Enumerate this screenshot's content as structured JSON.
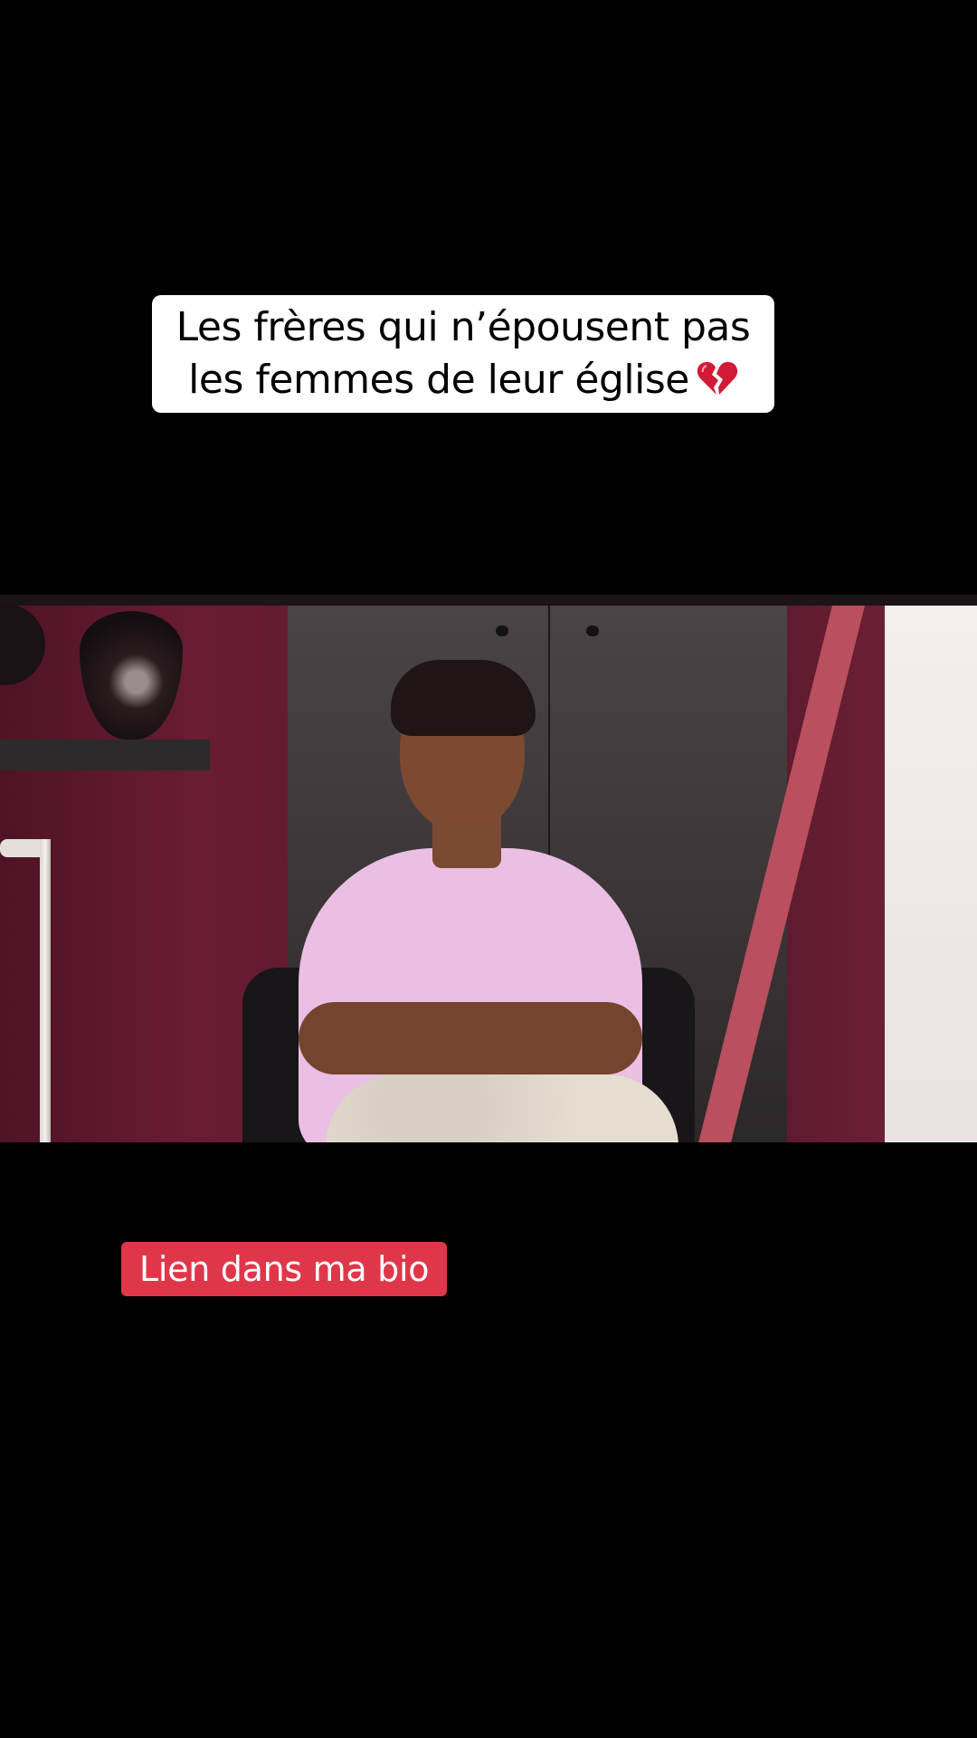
{
  "caption": {
    "line1": "Les frères qui n’épousent pas",
    "line2": "les femmes de leur église",
    "emoji": "broken-heart-icon"
  },
  "video": {
    "subject": "woman in pink t-shirt seated in chair"
  },
  "link_badge": {
    "label": "Lien dans ma bio"
  },
  "colors": {
    "background": "#000000",
    "caption_bg": "#ffffff",
    "badge_bg": "#e0364a",
    "badge_text": "#ffffff",
    "heart": "#d11a36"
  }
}
